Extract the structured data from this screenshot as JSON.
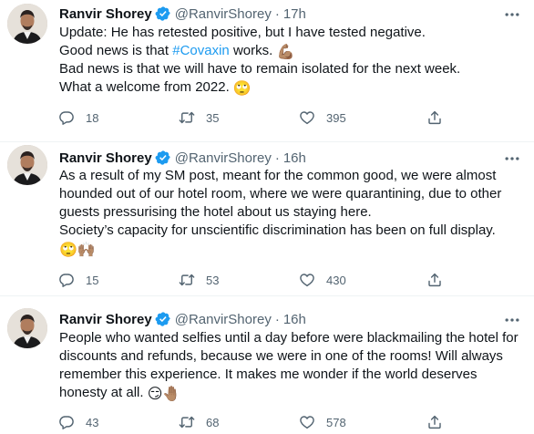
{
  "tweets": [
    {
      "name": "Ranvir Shorey",
      "handle": "@RanvirShorey",
      "separator": "·",
      "time": "17h",
      "lines": [
        "Update: He has retested positive, but I have tested negative.",
        "Good news is that ",
        "#Covaxin",
        " works. ",
        "Bad news is that we will have to remain isolated for the next week.",
        "What a welcome from 2022. "
      ],
      "emojis": [
        "💪🏽",
        "🙄"
      ],
      "replies": "18",
      "retweets": "35",
      "likes": "395"
    },
    {
      "name": "Ranvir Shorey",
      "handle": "@RanvirShorey",
      "separator": "·",
      "time": "16h",
      "lines": [
        "As a result of my SM post, meant for the common good, we were almost",
        "hounded out of our hotel room, where we were quarantining, due to other",
        "guests pressurising the hotel about us staying here.",
        "Society’s capacity for unscientific discrimination has been on full display."
      ],
      "emojis": [
        "🙄🙌🏽"
      ],
      "replies": "15",
      "retweets": "53",
      "likes": "430"
    },
    {
      "name": "Ranvir Shorey",
      "handle": "@RanvirShorey",
      "separator": "·",
      "time": "16h",
      "lines": [
        "People who wanted selfies until a day before were blackmailing the hotel for",
        "discounts and refunds, because we were in one of the rooms! Will always",
        "remember this experience. It makes me wonder if the world deserves",
        "honesty at all. "
      ],
      "emojis": [
        "😏🤚🏽"
      ],
      "replies": "43",
      "retweets": "68",
      "likes": "578"
    }
  ],
  "colors": {
    "text": "#0f1419",
    "secondary": "#536471",
    "link": "#1d9bf0",
    "verified": "#1d9bf0",
    "divider": "#eff3f4"
  },
  "icons": {
    "verified": "verified-badge-icon",
    "more": "more-options-icon",
    "reply": "reply-icon",
    "retweet": "retweet-icon",
    "like": "like-icon",
    "share": "share-icon"
  }
}
